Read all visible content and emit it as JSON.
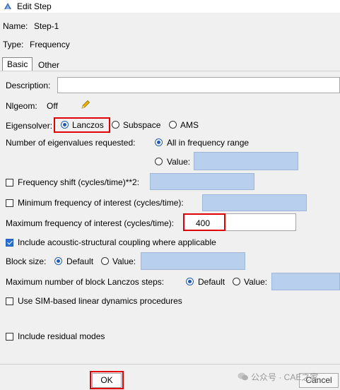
{
  "window": {
    "title": "Edit Step"
  },
  "step": {
    "name_label": "Name:",
    "name_value": "Step-1",
    "type_label": "Type:",
    "type_value": "Frequency"
  },
  "tabs": [
    {
      "label": "Basic",
      "active": true
    },
    {
      "label": "Other",
      "active": false
    }
  ],
  "basic": {
    "description_label": "Description:",
    "description_value": "",
    "nlgeom_label": "Nlgeom:",
    "nlgeom_value": "Off",
    "eigensolver_label": "Eigensolver:",
    "eigensolver_options": [
      "Lanczos",
      "Subspace",
      "AMS"
    ],
    "eigensolver_selected": "Lanczos",
    "num_eigen_label": "Number of eigenvalues requested:",
    "num_eigen_option_all": "All in frequency range",
    "num_eigen_option_value": "Value:",
    "num_eigen_value": "",
    "freq_shift_label": "Frequency shift (cycles/time)**2:",
    "freq_shift_value": "",
    "min_freq_label": "Minimum frequency of interest (cycles/time):",
    "min_freq_value": "",
    "max_freq_label": "Maximum frequency of interest (cycles/time):",
    "max_freq_value": "400",
    "acoustic_label": "Include acoustic-structural coupling where applicable",
    "block_size_label": "Block size:",
    "block_size_default": "Default",
    "block_size_value_label": "Value:",
    "block_size_value": "",
    "max_block_label": "Maximum number of block Lanczos steps:",
    "max_block_default": "Default",
    "max_block_value_label": "Value:",
    "max_block_value": "",
    "sim_label": "Use SIM-based linear dynamics procedures",
    "residual_label": "Include residual modes"
  },
  "buttons": {
    "ok": "OK",
    "cancel": "Cancel"
  },
  "watermark": "公众号 · CAE之家",
  "colors": {
    "highlight_red": "#e00000",
    "input_blue": "#b8d0ee",
    "accent": "#1f5bb8"
  },
  "icons": {
    "app": "abaqus-edit-icon",
    "nlgeom": "pencil-icon"
  }
}
